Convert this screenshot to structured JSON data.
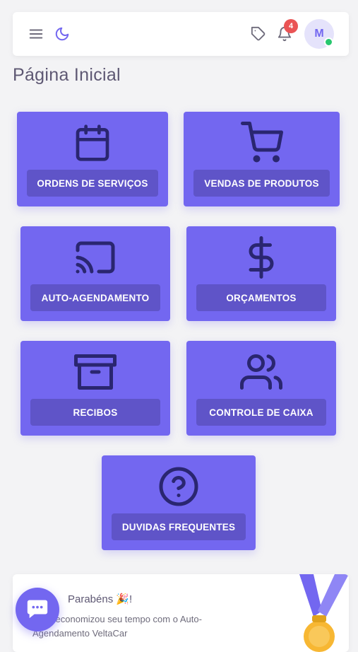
{
  "header": {
    "menu_icon": "menu-icon",
    "theme_icon": "moon-icon",
    "tag_icon": "tag-icon",
    "bell_icon": "bell-icon",
    "notification_count": "4",
    "avatar_initial": "M",
    "accent_color": "#7367f0",
    "online_color": "#28c76f"
  },
  "page": {
    "title": "Página Inicial"
  },
  "cards": [
    {
      "label": "ORDENS DE SERVIÇOS",
      "icon": "calendar-icon"
    },
    {
      "label": "VENDAS DE PRODUTOS",
      "icon": "cart-icon"
    },
    {
      "label": "AUTO-AGENDAMENTO",
      "icon": "cast-icon"
    },
    {
      "label": "ORÇAMENTOS",
      "icon": "dollar-icon"
    },
    {
      "label": "RECIBOS",
      "icon": "archive-icon"
    },
    {
      "label": "CONTROLE DE CAIXA",
      "icon": "users-icon"
    },
    {
      "label": "DUVIDAS FREQUENTES",
      "icon": "help-circle-icon"
    }
  ],
  "congrats": {
    "title": "Parabéns 🎉!",
    "message": "Você economizou seu tempo com o Auto-Agendamento VeltaCar"
  },
  "chat": {
    "icon": "chat-icon"
  }
}
